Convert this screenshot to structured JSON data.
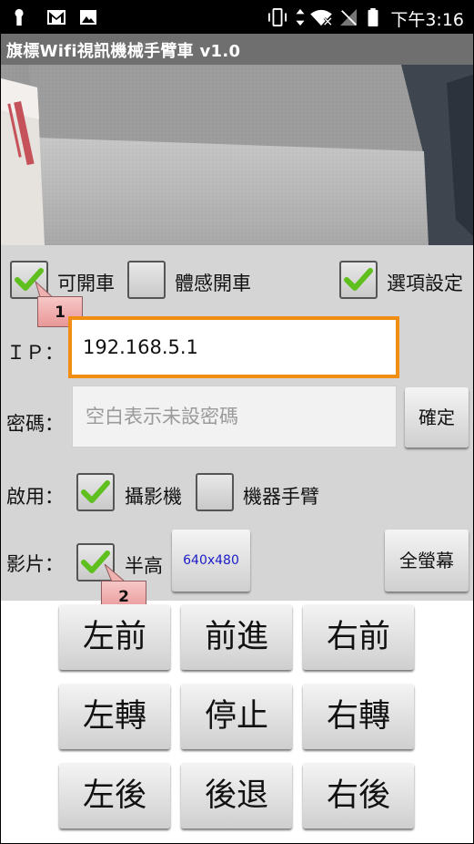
{
  "status_bar": {
    "time": "下午3:16",
    "icons": [
      "keyhole-icon",
      "gmail-icon",
      "image-icon",
      "vibrate-icon",
      "data-arrows-icon",
      "wifi-off-icon",
      "no-signal-icon",
      "battery-icon"
    ]
  },
  "app": {
    "title": "旗標Wifi視訊機械手臂車 v1.0"
  },
  "options": {
    "drive_label": "可開車",
    "drive_checked": true,
    "motion_label": "體感開車",
    "motion_checked": false,
    "settings_label": "選項設定",
    "settings_checked": true
  },
  "ip": {
    "label": "ＩＰ：",
    "value": "192.168.5.1"
  },
  "password": {
    "label": "密碼：",
    "placeholder": "空白表示未設密碼",
    "value": "",
    "confirm_label": "確定"
  },
  "enable": {
    "label": "啟用：",
    "camera_label": "攝影機",
    "camera_checked": true,
    "arm_label": "機器手臂",
    "arm_checked": false
  },
  "video": {
    "label": "影片：",
    "half_label": "半高",
    "half_checked": true,
    "resolution": "640x480",
    "fullscreen_label": "全螢幕"
  },
  "callouts": [
    "1",
    "2"
  ],
  "controls": {
    "row1": [
      "左前",
      "前進",
      "右前"
    ],
    "row2": [
      "左轉",
      "停止",
      "右轉"
    ],
    "row3": [
      "左後",
      "後退",
      "右後"
    ]
  },
  "colors": {
    "focus_orange": "#ef8e12",
    "check_green": "#5fbf1f",
    "resolution_blue": "#1c1cc8"
  }
}
